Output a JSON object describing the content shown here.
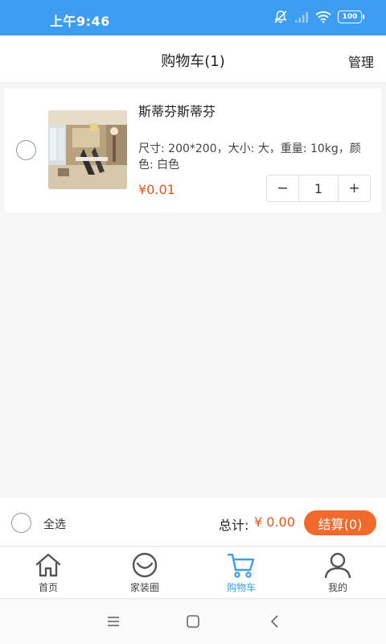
{
  "status_bar": {
    "time": "上午9:46",
    "battery": "100"
  },
  "header": {
    "title": "购物车(1)",
    "manage_label": "管理"
  },
  "cart": {
    "items": [
      {
        "name": "斯蒂芬斯蒂芬",
        "spec": "尺寸: 200*200，大小: 大，重量: 10kg，颜色: 白色",
        "price": "¥0.01",
        "quantity": "1",
        "minus_label": "−",
        "plus_label": "+",
        "selected": false
      }
    ]
  },
  "summary": {
    "select_all_label": "全选",
    "total_label": "总计:",
    "total_value": "¥ 0.00",
    "checkout_label": "结算(0)"
  },
  "tabbar": {
    "items": [
      {
        "label": "首页",
        "icon": "home-icon",
        "active": false
      },
      {
        "label": "家装圈",
        "icon": "smile-icon",
        "active": false
      },
      {
        "label": "购物车",
        "icon": "cart-icon",
        "active": true
      },
      {
        "label": "我的",
        "icon": "user-icon",
        "active": false
      }
    ]
  },
  "colors": {
    "accent": "#3d9df3",
    "price": "#e8541a",
    "checkout": "#f26a2b"
  }
}
